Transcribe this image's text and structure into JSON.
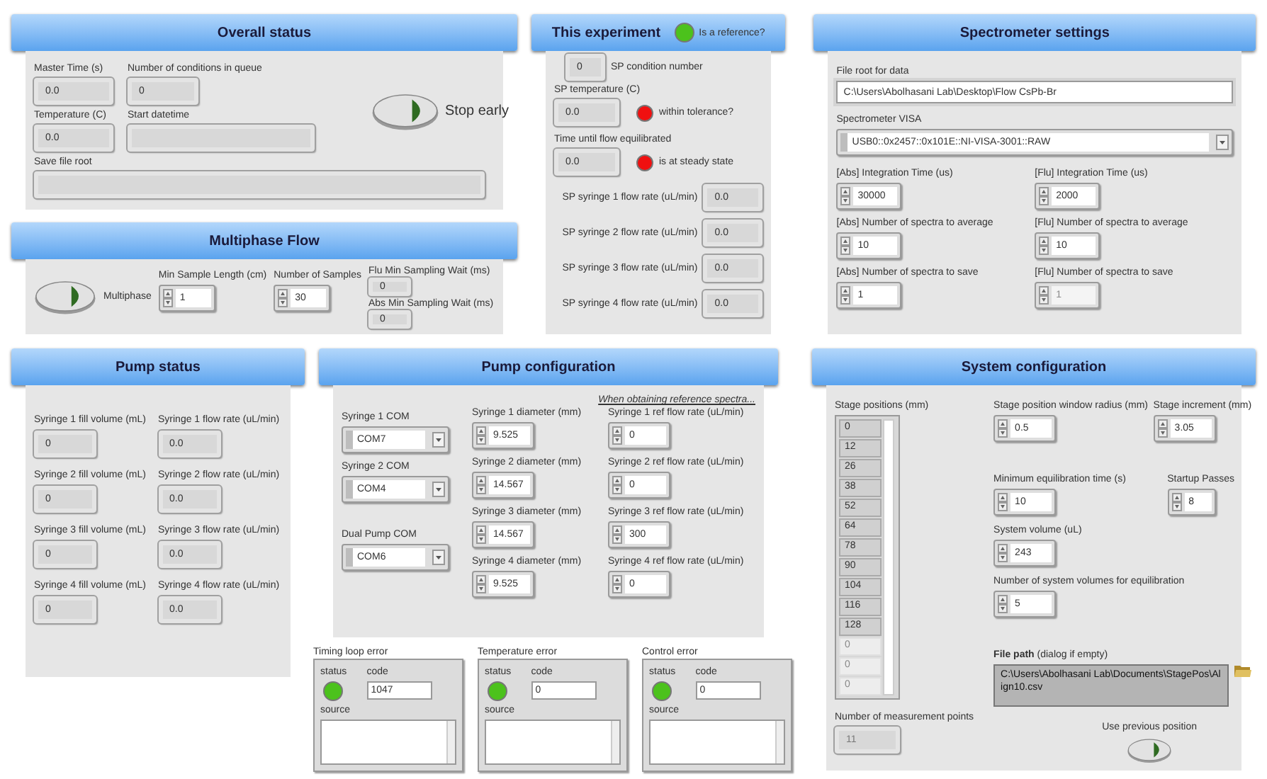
{
  "overall_status": {
    "title": "Overall status",
    "master_time": {
      "label": "Master Time (s)",
      "value": "0.0"
    },
    "conditions": {
      "label": "Number of conditions in queue",
      "value": "0"
    },
    "temperature": {
      "label": "Temperature (C)",
      "value": "0.0"
    },
    "start_datetime": {
      "label": "Start datetime"
    },
    "save_file_root": {
      "label": "Save file root"
    },
    "stop_button": {
      "label": "Stop early",
      "on": false
    }
  },
  "multiphase_flow": {
    "title": "Multiphase Flow",
    "switch": {
      "label": "Multiphase",
      "on": false
    },
    "controls": [
      {
        "label": "Min Sample Length (cm)",
        "value": "1"
      },
      {
        "label": "Number of Samples",
        "value": "30"
      }
    ],
    "indicators": [
      {
        "label": "Flu Min Sampling Wait (ms)",
        "value": "0"
      },
      {
        "label": "Abs Min Sampling Wait (ms)",
        "value": "0"
      }
    ]
  },
  "this_experiment": {
    "title": "This experiment",
    "reference": {
      "label": "Is a reference?",
      "on": true
    },
    "condition": {
      "label": "SP condition number",
      "value": "0"
    },
    "temperature": {
      "label": "SP temperature (C)",
      "value": "0.0"
    },
    "tolerance": {
      "label": "within tolerance?",
      "on": false
    },
    "time": {
      "label": "Time until flow equilibrated",
      "value": "0.0"
    },
    "steady": {
      "label": "is at steady state",
      "on": false
    },
    "flow_rates": [
      {
        "label": "SP syringe 1 flow rate (uL/min)",
        "value": "0.0"
      },
      {
        "label": "SP syringe 2 flow rate (uL/min)",
        "value": "0.0"
      },
      {
        "label": "SP syringe 3 flow rate (uL/min)",
        "value": "0.0"
      },
      {
        "label": "SP syringe 4 flow rate (uL/min)",
        "value": "0.0"
      }
    ]
  },
  "spectrometer": {
    "title": "Spectrometer settings",
    "file_root": {
      "label": "File root for data",
      "value": "C:\\Users\\Abolhasani Lab\\Desktop\\Flow CsPb-Br"
    },
    "visa": {
      "label": "Spectrometer VISA",
      "value": "USB0::0x2457::0x101E::NI-VISA-3001::RAW"
    },
    "abs": [
      {
        "label": "[Abs] Integration Time (us)",
        "value": "30000",
        "disabled": false
      },
      {
        "label": "[Abs] Number of spectra to average",
        "value": "10",
        "disabled": false
      },
      {
        "label": "[Abs] Number of spectra to save",
        "value": "1",
        "disabled": false
      }
    ],
    "flu": [
      {
        "label": "[Flu] Integration Time (us)",
        "value": "2000",
        "disabled": false
      },
      {
        "label": "[Flu] Number of spectra to average",
        "value": "10",
        "disabled": false
      },
      {
        "label": "[Flu] Number of spectra to save",
        "value": "1",
        "disabled": true
      }
    ]
  },
  "pump_status": {
    "title": "Pump status",
    "rows": [
      {
        "volume": {
          "label": "Syringe 1 fill volume (mL)",
          "value": "0"
        },
        "rate": {
          "label": "Syringe 1 flow rate (uL/min)",
          "value": "0.0"
        }
      },
      {
        "volume": {
          "label": "Syringe 2 fill volume (mL)",
          "value": "0"
        },
        "rate": {
          "label": "Syringe 2 flow rate (uL/min)",
          "value": "0.0"
        }
      },
      {
        "volume": {
          "label": "Syringe 3 fill volume (mL)",
          "value": "0"
        },
        "rate": {
          "label": "Syringe 3 flow rate (uL/min)",
          "value": "0.0"
        }
      },
      {
        "volume": {
          "label": "Syringe 4 fill volume (mL)",
          "value": "0"
        },
        "rate": {
          "label": "Syringe 4 flow rate (uL/min)",
          "value": "0.0"
        }
      }
    ]
  },
  "pump_configuration": {
    "title": "Pump configuration",
    "note": "When obtaining reference spectra...",
    "com_ports": [
      {
        "label": "Syringe 1 COM",
        "value": "COM7"
      },
      {
        "label": "Syringe 2 COM",
        "value": "COM4"
      },
      {
        "label": "Dual Pump COM",
        "value": "COM6"
      }
    ],
    "diameters": [
      {
        "label": "Syringe 1 diameter (mm)",
        "value": "9.525"
      },
      {
        "label": "Syringe 2 diameter (mm)",
        "value": "14.567"
      },
      {
        "label": "Syringe 3 diameter (mm)",
        "value": "14.567"
      },
      {
        "label": "Syringe 4 diameter (mm)",
        "value": "9.525"
      }
    ],
    "ref_rates": [
      {
        "label": "Syringe 1 ref flow rate (uL/min)",
        "value": "0"
      },
      {
        "label": "Syringe 2 ref flow rate (uL/min)",
        "value": "0"
      },
      {
        "label": "Syringe 3 ref flow rate (uL/min)",
        "value": "300"
      },
      {
        "label": "Syringe 4 ref flow rate (uL/min)",
        "value": "0"
      }
    ]
  },
  "errors": [
    {
      "title": "Timing loop error",
      "status_label": "status",
      "on": true,
      "code_label": "code",
      "code": "1047",
      "source_label": "source"
    },
    {
      "title": "Temperature error",
      "status_label": "status",
      "on": true,
      "code_label": "code",
      "code": "0",
      "source_label": "source"
    },
    {
      "title": "Control error",
      "status_label": "status",
      "on": true,
      "code_label": "code",
      "code": "0",
      "source_label": "source"
    }
  ],
  "system_configuration": {
    "title": "System configuration",
    "stage_positions": {
      "label": "Stage positions (mm)",
      "items": [
        {
          "value": "0",
          "disabled": false
        },
        {
          "value": "12",
          "disabled": false
        },
        {
          "value": "26",
          "disabled": false
        },
        {
          "value": "38",
          "disabled": false
        },
        {
          "value": "52",
          "disabled": false
        },
        {
          "value": "64",
          "disabled": false
        },
        {
          "value": "78",
          "disabled": false
        },
        {
          "value": "90",
          "disabled": false
        },
        {
          "value": "104",
          "disabled": false
        },
        {
          "value": "116",
          "disabled": false
        },
        {
          "value": "128",
          "disabled": false
        },
        {
          "value": "0",
          "disabled": true
        },
        {
          "value": "0",
          "disabled": true
        },
        {
          "value": "0",
          "disabled": true
        }
      ]
    },
    "window_radius": {
      "label": "Stage position window radius (mm)",
      "value": "0.5"
    },
    "increment": {
      "label": "Stage increment (mm)",
      "value": "3.05"
    },
    "min_equilibration": {
      "label": "Minimum equilibration time (s)",
      "value": "10"
    },
    "startup_passes": {
      "label": "Startup Passes",
      "value": "8"
    },
    "system_volume": {
      "label": "System volume (uL)",
      "value": "243"
    },
    "num_volumes": {
      "label": "Number of system volumes for equilibration",
      "value": "5"
    },
    "file_path": {
      "label": "**File path** (dialog if empty)",
      "value": "C:\\Users\\Abolhasani Lab\\Documents\\StagePos\\Align10.csv"
    },
    "measurement_points": {
      "label": "Number of measurement points",
      "value": "11"
    },
    "use_previous": {
      "label": "Use previous position",
      "on": false
    }
  }
}
